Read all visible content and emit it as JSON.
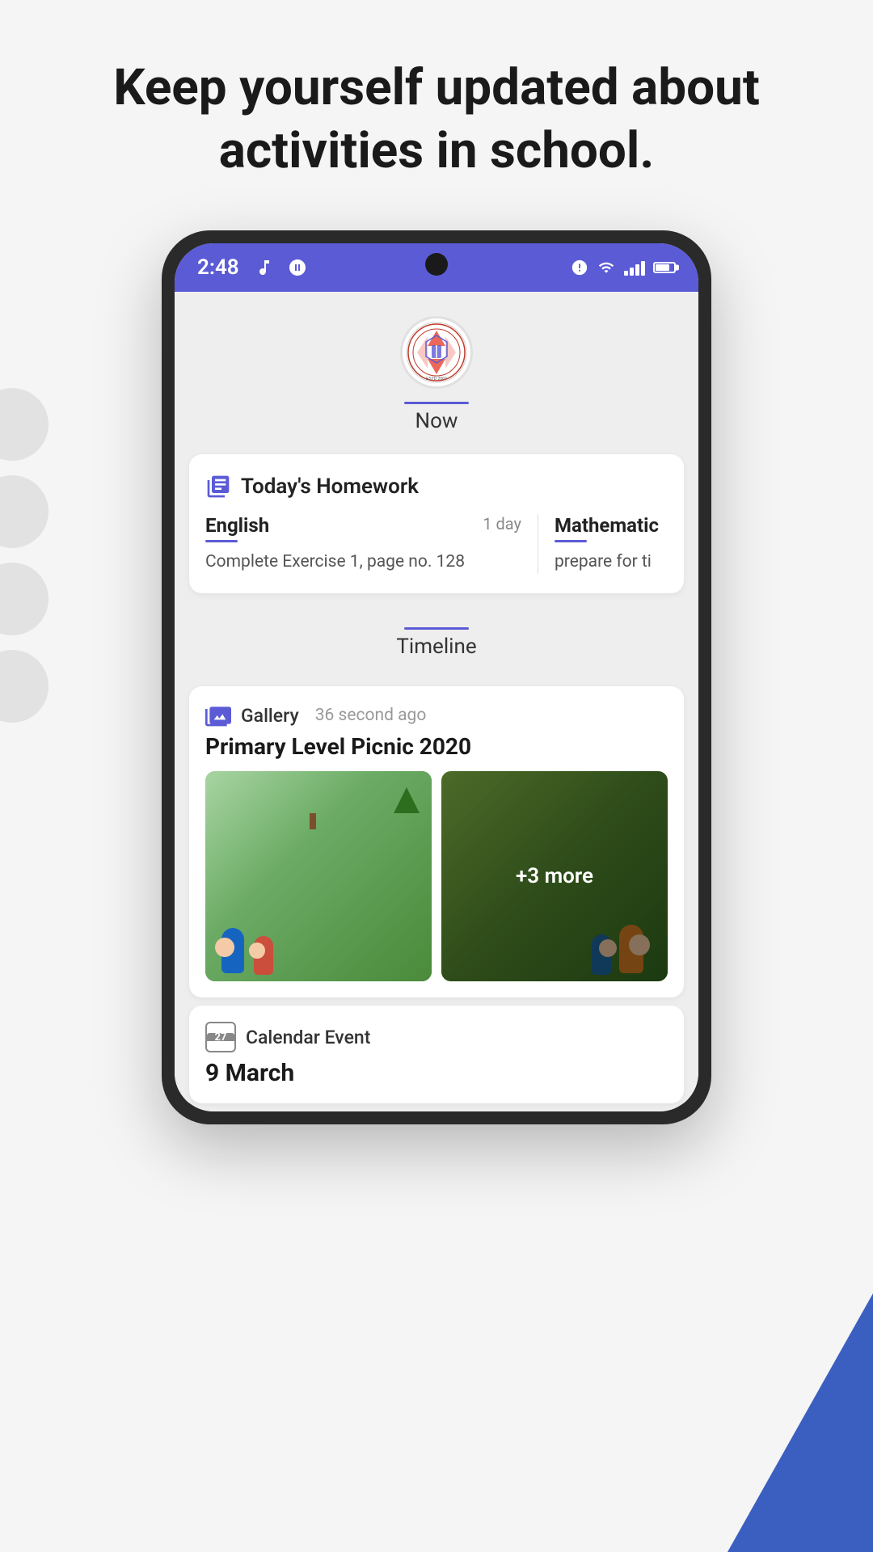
{
  "header": {
    "title": "Keep yourself updated about activities in school."
  },
  "phone": {
    "statusBar": {
      "time": "2:48",
      "iconsLeft": [
        "music-icon",
        "whatsapp-icon"
      ],
      "iconsRight": [
        "alarm-icon",
        "wifi-icon",
        "signal-icon",
        "battery-icon"
      ]
    }
  },
  "nowTab": {
    "label": "Now"
  },
  "homeworkSection": {
    "title": "Today's Homework",
    "items": [
      {
        "subject": "English",
        "days": "1 day",
        "description": "Complete Exercise 1, page no. 128"
      },
      {
        "subject": "Mathematic",
        "days": "",
        "description": "prepare for ti"
      }
    ]
  },
  "timelineTab": {
    "label": "Timeline"
  },
  "galleryPost": {
    "type": "Gallery",
    "time": "36 second ago",
    "title": "Primary Level Picnic 2020",
    "moreCount": "+3 more"
  },
  "calendarEvent": {
    "type": "Calendar Event",
    "iconNum": "27",
    "date": "9 March"
  }
}
